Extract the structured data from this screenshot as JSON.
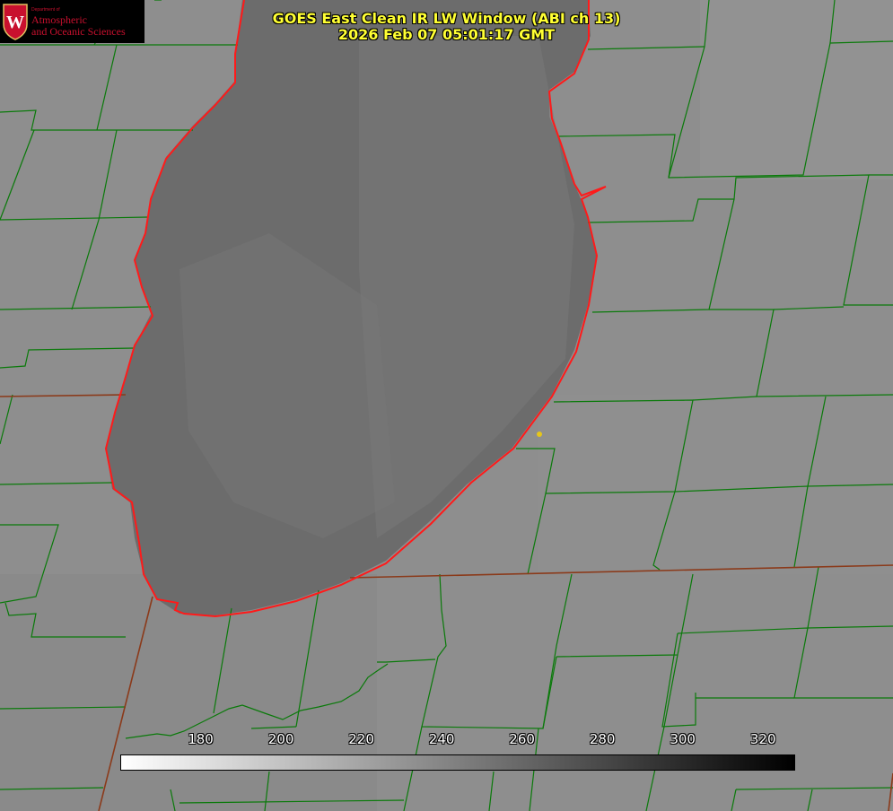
{
  "title_line1": "GOES East Clean IR LW Window (ABI ch 13)",
  "title_line2": "2026 Feb 07 05:01:17 GMT",
  "logo": {
    "department": "Department of",
    "line1": "Atmospheric",
    "line2": "and Oceanic Sciences",
    "crest_letter": "W"
  },
  "colorbar": {
    "unit_range": [
      160,
      328
    ],
    "ticks": [
      "180",
      "200",
      "220",
      "240",
      "260",
      "280",
      "300",
      "320"
    ],
    "gradient_from": "#ffffff",
    "gradient_to": "#000000"
  },
  "colors": {
    "background": "#8c8c8c",
    "lake": "#6e6e6e",
    "county_lines": "#0a7a0a",
    "shoreline": "#ff1a1a",
    "state_lines": "#8b3a1a",
    "title_text": "#ffff33",
    "marker": "#e6c619"
  },
  "icons": {
    "crest": "uw-crest-icon",
    "location_marker": "marker-dot-icon"
  }
}
